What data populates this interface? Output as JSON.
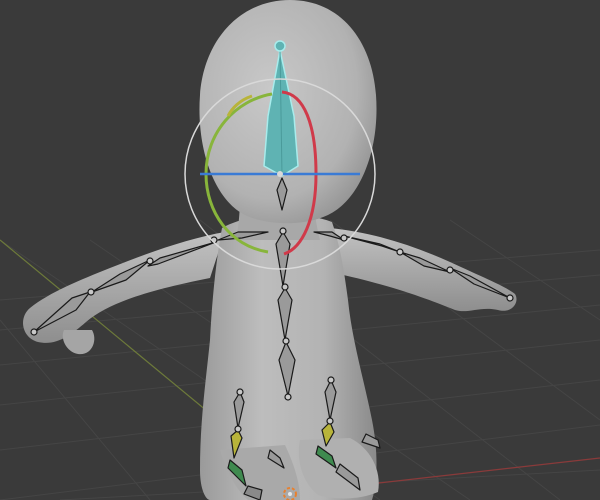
{
  "viewport": {
    "mode": "pose",
    "active_bone": "head",
    "colors": {
      "background": "#3a3a3a",
      "grid_line": "#444444",
      "mesh": "#b4b4b4",
      "mesh_shadow": "#8c8c8c",
      "bone_fill": "#9a9a9a",
      "bone_outline": "#1a1a1a",
      "active_bone": "#5fb3b3",
      "active_bone_outline": "#a8ecec",
      "x_axis": "#d03a4a",
      "y_axis": "#88b53b",
      "z_axis": "#3a7bd5",
      "trackball": "#d9d9d9",
      "ik_yellow": "#b8b43a",
      "fk_green": "#3f8a4f",
      "origin": "#e8802e"
    },
    "icons": {
      "rotate_gizmo": "rotate-gizmo-icon",
      "origin": "origin-cursor-icon"
    }
  }
}
